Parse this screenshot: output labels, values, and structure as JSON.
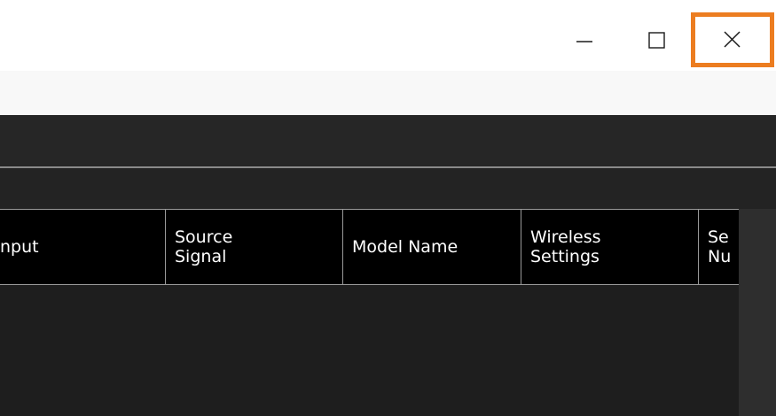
{
  "window": {
    "minimize_icon": "minimize-icon",
    "maximize_icon": "maximize-icon",
    "close_icon": "close-icon",
    "close_highlight_color": "#ec7d20"
  },
  "table": {
    "columns": [
      {
        "label": "nput"
      },
      {
        "label": "Source\nSignal"
      },
      {
        "label": "Model Name"
      },
      {
        "label": "Wireless\nSettings"
      },
      {
        "label": "Se\nNu"
      }
    ]
  }
}
